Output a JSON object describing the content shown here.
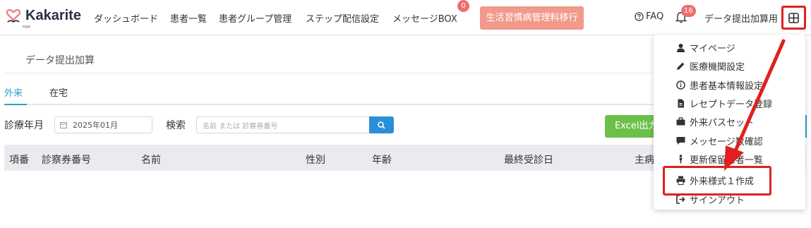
{
  "brand": {
    "name": "Kakarite",
    "sub": "FRM"
  },
  "nav": [
    {
      "label": "ダッシュボード"
    },
    {
      "label": "患者一覧"
    },
    {
      "label": "患者グループ管理"
    },
    {
      "label": "ステップ配信設定"
    },
    {
      "label": "メッセージBOX",
      "badge": "0"
    }
  ],
  "header": {
    "seikatsu_button": "生活習慣病管理料移行",
    "faq": "FAQ",
    "notification_count": "16",
    "user_name": "データ提出加算用"
  },
  "page": {
    "title": "データ提出加算",
    "tabs": [
      {
        "label": "外来",
        "active": true
      },
      {
        "label": "在宅",
        "active": false
      }
    ]
  },
  "filters": {
    "date_label": "診療年月",
    "date_value": "2025年01月",
    "search_label": "検索",
    "search_placeholder": "名前 または 診察券番号",
    "excel_button": "Excel出力"
  },
  "table": {
    "headers": [
      "項番",
      "診察券番号",
      "名前",
      "性別",
      "年齢",
      "最終受診日",
      "主病"
    ]
  },
  "menu": {
    "items": [
      {
        "label": "マイページ",
        "icon": "user-icon"
      },
      {
        "label": "医療機関設定",
        "icon": "pencil-icon"
      },
      {
        "label": "患者基本情報設定",
        "icon": "info-icon"
      },
      {
        "label": "レセプトデータ登録",
        "icon": "file-icon"
      },
      {
        "label": "外来パスセット",
        "icon": "briefcase-icon"
      },
      {
        "label": "メッセージ数確認",
        "icon": "comment-icon"
      },
      {
        "label": "更新保留患者一覧",
        "icon": "person-icon"
      },
      {
        "label": "外来様式１作成",
        "icon": "print-icon",
        "highlighted": true
      },
      {
        "label": "サインアウト",
        "icon": "signout-icon"
      }
    ]
  },
  "colors": {
    "accent": "#2aa0c8",
    "highlight": "#e02020",
    "excel": "#6cc04a",
    "seikatsu": "#f1998b",
    "search": "#2a8fd8"
  }
}
